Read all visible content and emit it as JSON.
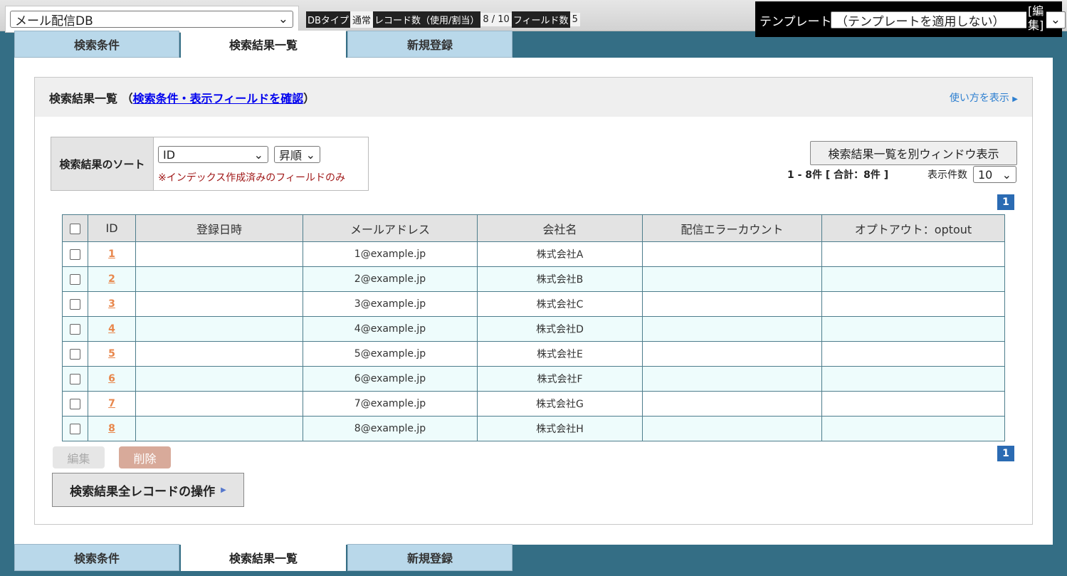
{
  "topbar": {
    "db_name": "メール配信DB",
    "meta": [
      {
        "key": "DBタイプ",
        "value": "通常"
      },
      {
        "key": "レコード数（使用/割当）",
        "value": "8 / 10"
      },
      {
        "key": "フィールド数",
        "value": "5"
      }
    ],
    "template_label": "テンプレート",
    "template_value": "（テンプレートを適用しない）",
    "template_edit": "[編集]"
  },
  "tabs": [
    "検索条件",
    "検索結果一覧",
    "新規登録"
  ],
  "active_tab": "検索結果一覧",
  "panel": {
    "title": "検索結果一覧",
    "title_link": "検索条件・表示フィールドを確認",
    "usage_link": "使い方を表示",
    "sort_label": "検索結果のソート",
    "sort_field": "ID",
    "sort_order": "昇順",
    "sort_note": "※インデックス作成済みのフィールドのみ",
    "popup_button": "検索結果一覧を別ウィンドウ表示",
    "count_text": "1 - 8件 [ 合計：8件 ]",
    "perpage_label": "表示件数",
    "perpage_value": "10",
    "page": "1"
  },
  "table": {
    "headers": [
      "ID",
      "登録日時",
      "メールアドレス",
      "会社名",
      "配信エラーカウント",
      "オプトアウト：optout"
    ],
    "rows": [
      {
        "id": "1",
        "date": "",
        "email": "1@example.jp",
        "company": "株式会社A",
        "errors": "",
        "optout": ""
      },
      {
        "id": "2",
        "date": "",
        "email": "2@example.jp",
        "company": "株式会社B",
        "errors": "",
        "optout": ""
      },
      {
        "id": "3",
        "date": "",
        "email": "3@example.jp",
        "company": "株式会社C",
        "errors": "",
        "optout": ""
      },
      {
        "id": "4",
        "date": "",
        "email": "4@example.jp",
        "company": "株式会社D",
        "errors": "",
        "optout": ""
      },
      {
        "id": "5",
        "date": "",
        "email": "5@example.jp",
        "company": "株式会社E",
        "errors": "",
        "optout": ""
      },
      {
        "id": "6",
        "date": "",
        "email": "6@example.jp",
        "company": "株式会社F",
        "errors": "",
        "optout": ""
      },
      {
        "id": "7",
        "date": "",
        "email": "7@example.jp",
        "company": "株式会社G",
        "errors": "",
        "optout": ""
      },
      {
        "id": "8",
        "date": "",
        "email": "8@example.jp",
        "company": "株式会社H",
        "errors": "",
        "optout": ""
      }
    ]
  },
  "actions": {
    "edit": "編集",
    "delete": "削除",
    "all_records": "検索結果全レコードの操作"
  },
  "icons": {
    "dropdown": "chevron-down-icon",
    "arrow": "triangle-right-icon"
  },
  "colors": {
    "background": "#346e85",
    "tab_inactive": "#b9d8ea",
    "link": "#0000ee",
    "id_link": "#e8874c",
    "note": "#a01818",
    "pager": "#2b6bb3"
  }
}
